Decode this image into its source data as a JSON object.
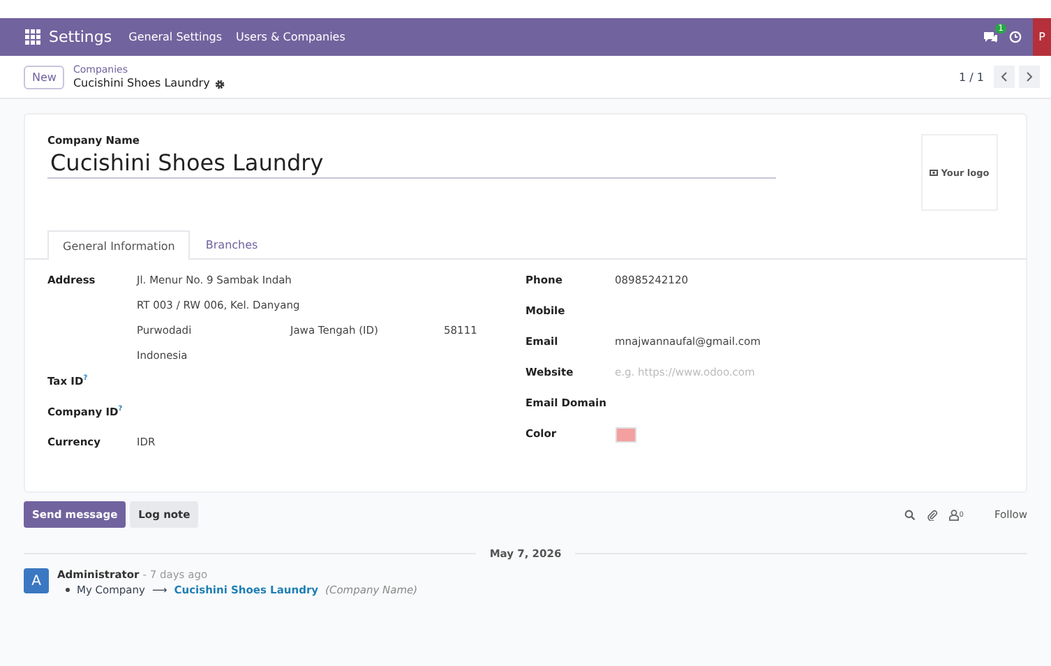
{
  "navbar": {
    "app_name": "Settings",
    "menu": [
      "General Settings",
      "Users & Companies"
    ],
    "chat_badge": "1",
    "avatar": "P"
  },
  "control_panel": {
    "new_button": "New",
    "breadcrumb_parent": "Companies",
    "breadcrumb_current": "Cucishini Shoes Laundry",
    "pager": "1 / 1"
  },
  "form": {
    "name_label": "Company Name",
    "name": "Cucishini Shoes Laundry",
    "logo_label": "Your logo",
    "tabs": [
      {
        "label": "General Information",
        "selected": true
      },
      {
        "label": "Branches",
        "selected": false
      }
    ],
    "left_fields": [
      {
        "kind": "address",
        "label": "Address",
        "lines": [
          [
            "Jl. Menur No. 9 Sambak Indah"
          ],
          [
            "RT 003 / RW 006, Kel. Danyang"
          ],
          [
            "Purwodadi",
            "Jawa Tengah (ID)",
            "58111"
          ],
          [
            "Indonesia"
          ]
        ]
      },
      {
        "kind": "text",
        "label": "Tax ID",
        "help": "?"
      },
      {
        "kind": "text",
        "label": "Company ID",
        "help": "?"
      },
      {
        "kind": "text",
        "label": "Currency",
        "value": "IDR"
      }
    ],
    "right_fields": [
      {
        "kind": "text",
        "label": "Phone",
        "value": "08985242120"
      },
      {
        "kind": "text",
        "label": "Mobile"
      },
      {
        "kind": "text",
        "label": "Email",
        "value": "mnajwannaufal@gmail.com"
      },
      {
        "kind": "text",
        "label": "Website",
        "placeholder": "e.g. https://www.odoo.com"
      },
      {
        "kind": "text",
        "label": "Email Domain"
      },
      {
        "kind": "color",
        "label": "Color",
        "color": "#f4a0a0"
      }
    ]
  },
  "chatter": {
    "send_button": "Send message",
    "log_button": "Log note",
    "followers_count": "0",
    "follow": "Follow",
    "date": "May 7, 2026",
    "message": {
      "avatar": "A",
      "author": "Administrator",
      "time": "- 7 days ago",
      "old_value": "My Company",
      "arrow": "⟶",
      "new_value": "Cucishini Shoes Laundry",
      "field": "(Company Name)"
    }
  }
}
